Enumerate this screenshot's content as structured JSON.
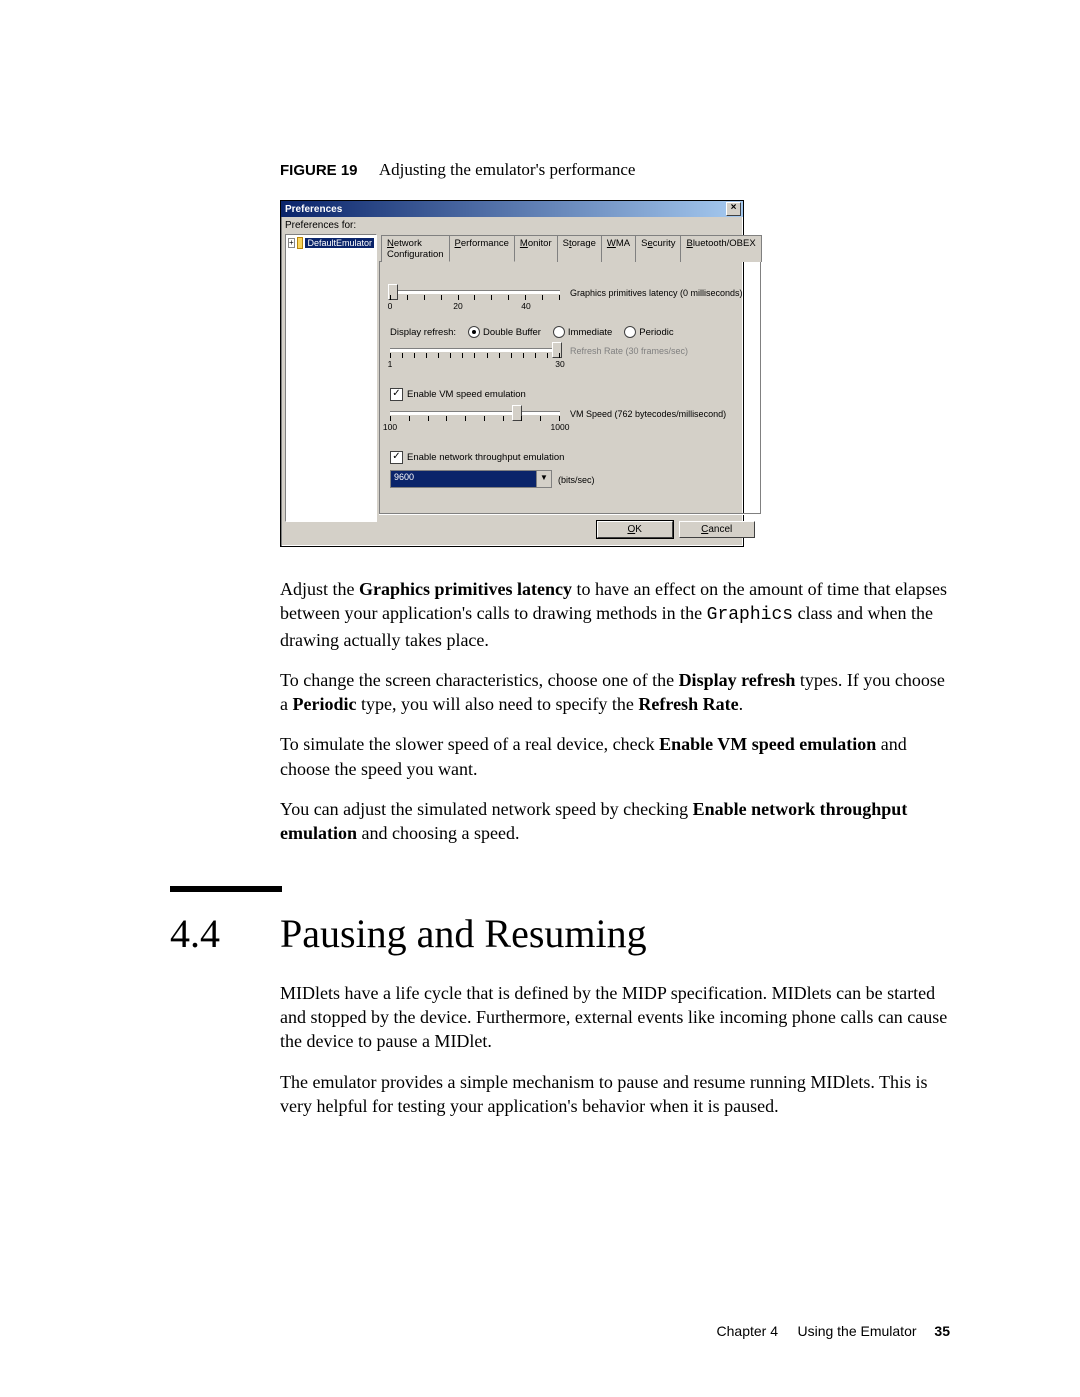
{
  "figure": {
    "label": "FIGURE 19",
    "caption": "Adjusting the emulator's performance"
  },
  "window": {
    "title": "Preferences",
    "preferences_for": "Preferences for:",
    "tree_item": "DefaultEmulator",
    "tabs": {
      "network": "Network Configuration",
      "performance": "Performance",
      "monitor": "Monitor",
      "storage": "Storage",
      "wma": "WMA",
      "security": "Security",
      "bluetooth": "Bluetooth/OBEX"
    },
    "perf": {
      "slider1_label": "Graphics primitives latency (0 milliseconds)",
      "slider1_min": "0",
      "slider1_mid": "20",
      "slider1_mid2": "40",
      "display_refresh_label": "Display refresh:",
      "radio_double": "Double Buffer",
      "radio_immediate": "Immediate",
      "radio_periodic": "Periodic",
      "refresh_rate_label": "Refresh Rate (30 frames/sec)",
      "refresh_min": "1",
      "refresh_max": "30",
      "chk_vm": "Enable VM speed emulation",
      "vm_speed_label": "VM Speed (762 bytecodes/millisecond)",
      "vm_min": "100",
      "vm_max": "1000",
      "chk_net": "Enable network throughput emulation",
      "net_value": "9600",
      "net_unit": "(bits/sec)"
    },
    "buttons": {
      "ok": "OK",
      "cancel": "Cancel"
    }
  },
  "body": {
    "p1a": "Adjust the ",
    "p1b": "Graphics primitives latency",
    "p1c": " to have an effect on the amount of time that elapses between your application's calls to drawing methods in the ",
    "p1code": "Graphics",
    "p1d": " class and when the drawing actually takes place.",
    "p2a": "To change the screen characteristics, choose one of the ",
    "p2b": "Display refresh",
    "p2c": " types. If you choose a ",
    "p2d": "Periodic",
    "p2e": " type, you will also need to specify the ",
    "p2f": "Refresh Rate",
    "p2g": ".",
    "p3a": "To simulate the slower speed of a real device, check ",
    "p3b": "Enable VM speed emulation",
    "p3c": " and choose the speed you want.",
    "p4a": "You can adjust the simulated network speed by checking ",
    "p4b": "Enable network throughput emulation",
    "p4c": " and choosing a speed."
  },
  "section": {
    "num": "4.4",
    "title": "Pausing and Resuming",
    "p1": "MIDlets have a life cycle that is defined by the MIDP specification. MIDlets can be started and stopped by the device. Furthermore, external events like incoming phone calls can cause the device to pause a MIDlet.",
    "p2": "The emulator provides a simple mechanism to pause and resume running MIDlets. This is very helpful for testing your application's behavior when it is paused."
  },
  "footer": {
    "chapter": "Chapter 4",
    "title": "Using the Emulator",
    "page": "35"
  }
}
